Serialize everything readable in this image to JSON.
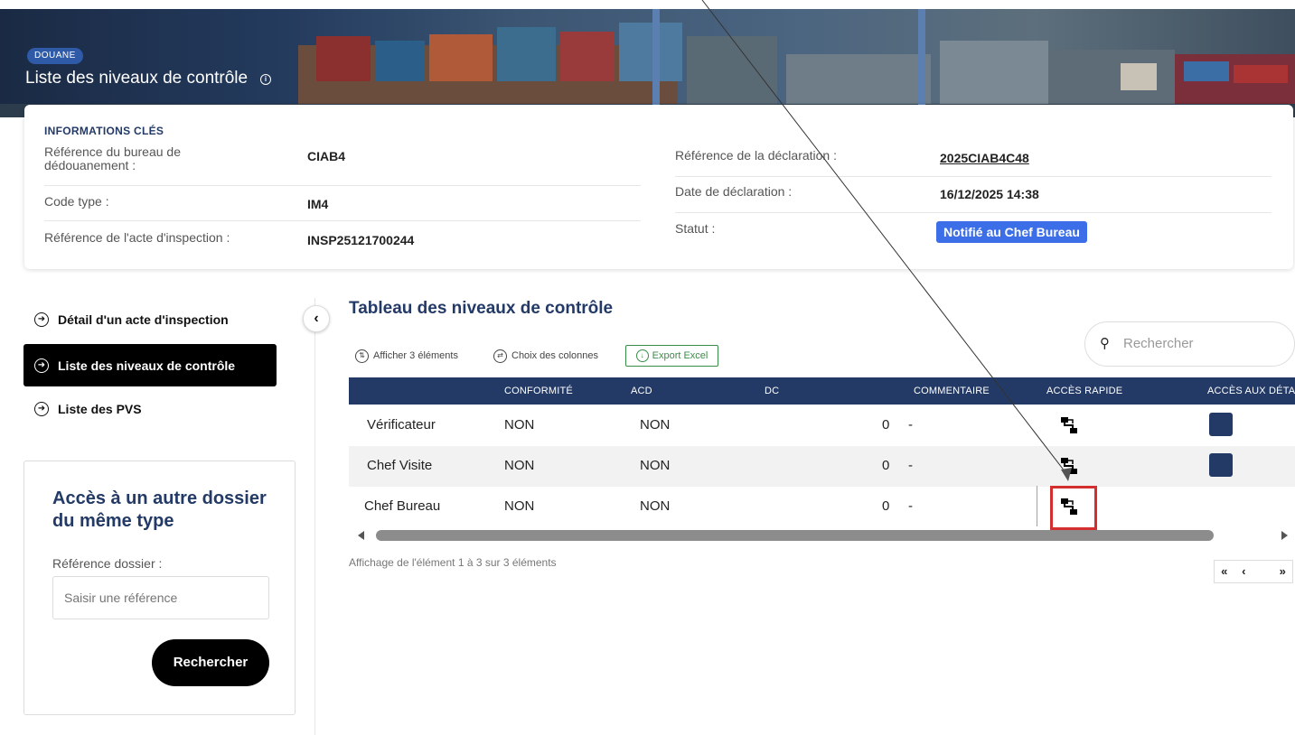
{
  "header": {
    "badge": "DOUANE",
    "title": "Liste des niveaux de contrôle",
    "info_icon": "info-circle-icon"
  },
  "key_info": {
    "heading": "INFORMATIONS CLÉS",
    "left": [
      {
        "label": "Référence du bureau de dédouanement :",
        "value": "CIAB4"
      },
      {
        "label": "Code type :",
        "value": "IM4"
      },
      {
        "label": "Référence de l'acte d'inspection :",
        "value": "INSP25121700244"
      }
    ],
    "right": [
      {
        "label": "Référence de la déclaration :",
        "value": "2025CIAB4C48"
      },
      {
        "label": "Date de déclaration :",
        "value": "16/12/2025 14:38"
      },
      {
        "label": "Statut :",
        "value": "Notifié au Chef Bureau"
      }
    ],
    "status_color": "#3c6ee8"
  },
  "nav": {
    "items": [
      {
        "label": "Détail d'un acte d'inspection",
        "icon": "arrow-right-circle-icon",
        "active": false
      },
      {
        "label": "Liste des niveaux de contrôle",
        "icon": "arrow-right-circle-icon",
        "active": true
      },
      {
        "label": "Liste des PVS",
        "icon": "arrow-right-circle-icon",
        "active": false
      }
    ],
    "collapse_icon": "chevron-left-icon"
  },
  "side_search": {
    "title": "Accès à un autre dossier du même type",
    "label": "Référence dossier :",
    "placeholder": "Saisir une référence",
    "button": "Rechercher"
  },
  "table": {
    "title": "Tableau des niveaux de contrôle",
    "toolbar": {
      "show": "Afficher 3 éléments",
      "columns": "Choix des colonnes",
      "export": "Export Excel",
      "search_placeholder": "Rechercher"
    },
    "headers": [
      "",
      "CONFORMITÉ",
      "ACD",
      "DC",
      "COMMENTAIRE",
      "ACCÈS RAPIDE",
      "ACCÈS AUX DÉTA"
    ],
    "rows": [
      {
        "role": "Vérificateur",
        "conformite": "NON",
        "acd": "NON",
        "dc": "0",
        "commentaire": "-",
        "detail": true
      },
      {
        "role": "Chef Visite",
        "conformite": "NON",
        "acd": "NON",
        "dc": "0",
        "commentaire": "-",
        "detail": true
      },
      {
        "role": "Chef Bureau",
        "conformite": "NON",
        "acd": "NON",
        "dc": "0",
        "commentaire": "-",
        "detail": false
      }
    ],
    "footer": "Affichage de l'élément 1 à 3 sur 3 éléments",
    "pager": [
      "«",
      "‹",
      "",
      "»"
    ],
    "header_color": "#233a66",
    "highlight_color": "#d32f2f"
  }
}
